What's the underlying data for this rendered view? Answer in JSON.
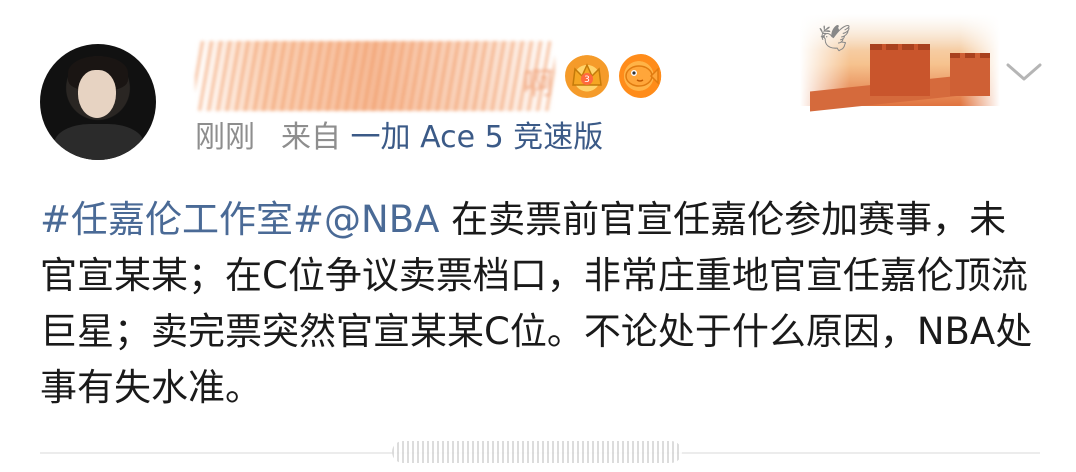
{
  "post": {
    "author": {
      "name_visible_fragment": "啊"
    },
    "badges": [
      {
        "icon": "crown-badge-icon",
        "label": "3"
      },
      {
        "icon": "fish-badge-icon"
      }
    ],
    "timestamp": "刚刚",
    "source_prefix": "来自",
    "source": "一加 Ace 5 竞速版",
    "content": {
      "topic1": "#任嘉伦工作室#",
      "mention": "@NBA",
      "text": " 在卖票前官宣任嘉伦参加赛事，未官宣某某；在C位争议卖票档口，非常庄重地官宣任嘉伦顶流巨星；卖完票突然官宣某某C位。不论处于什么原因，NBA处事有失水准。"
    }
  },
  "colors": {
    "link": "#4a6a96",
    "meta": "#8e8e8e",
    "text": "#1a1a1a"
  }
}
